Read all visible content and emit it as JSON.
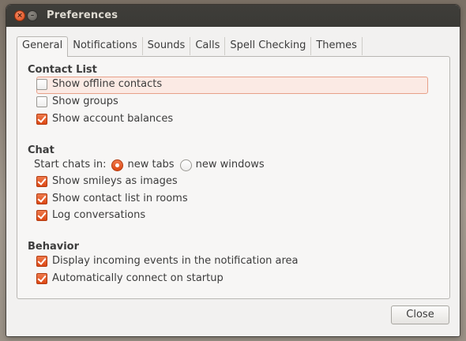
{
  "window": {
    "title": "Preferences"
  },
  "tabs": [
    {
      "label": "General",
      "active": true
    },
    {
      "label": "Notifications",
      "active": false
    },
    {
      "label": "Sounds",
      "active": false
    },
    {
      "label": "Calls",
      "active": false
    },
    {
      "label": "Spell Checking",
      "active": false
    },
    {
      "label": "Themes",
      "active": false
    }
  ],
  "contact_list": {
    "title": "Contact List",
    "show_offline": {
      "label": "Show offline contacts",
      "checked": false
    },
    "show_groups": {
      "label": "Show groups",
      "checked": false
    },
    "show_balances": {
      "label": "Show account balances",
      "checked": true
    }
  },
  "chat": {
    "title": "Chat",
    "start_label": "Start chats in:",
    "option_tabs": {
      "label": "new tabs",
      "selected": true
    },
    "option_windows": {
      "label": "new windows",
      "selected": false
    },
    "smileys": {
      "label": "Show smileys as images",
      "checked": true
    },
    "contact_rooms": {
      "label": "Show contact list in rooms",
      "checked": true
    },
    "log": {
      "label": "Log conversations",
      "checked": true
    }
  },
  "behavior": {
    "title": "Behavior",
    "notify": {
      "label": "Display incoming events in the notification area",
      "checked": true
    },
    "autoconnect": {
      "label": "Automatically connect on startup",
      "checked": true
    }
  },
  "footer": {
    "close_label": "Close"
  },
  "colors": {
    "accent": "#dd4814",
    "titlebar": "#3c3b37"
  }
}
